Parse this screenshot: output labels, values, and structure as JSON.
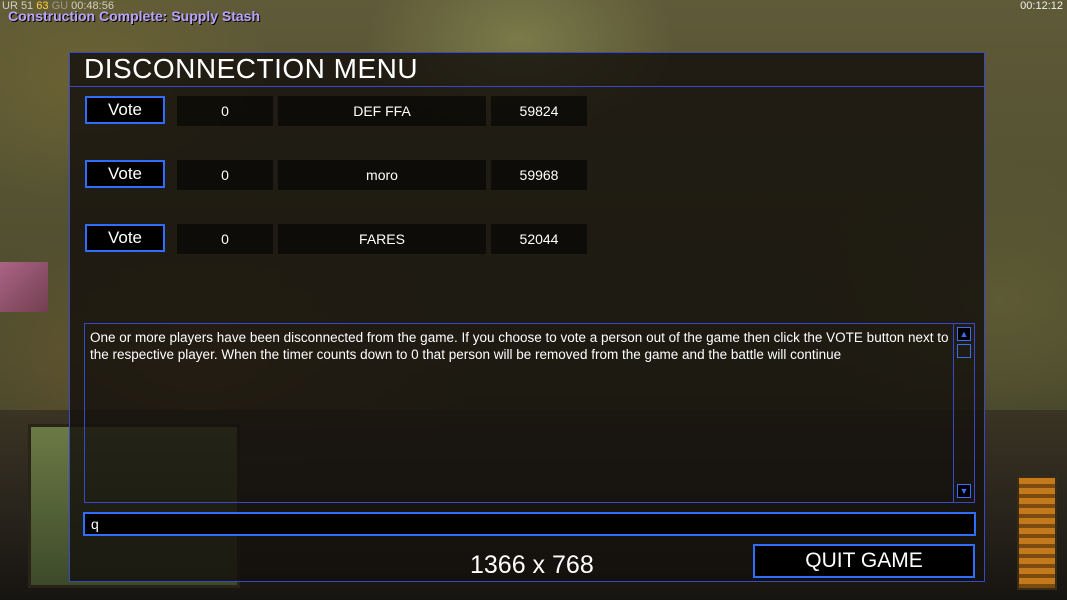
{
  "hud": {
    "stats_prefix": "UR 51",
    "stats_highlight": "63",
    "stats_dim": "GU",
    "stats_timer": "00:48:56",
    "notification": "Construction Complete: Supply Stash",
    "clock": "00:12:12"
  },
  "dialog": {
    "title": "DISCONNECTION MENU",
    "vote_label": "Vote",
    "players": [
      {
        "votes": "0",
        "name": "DEF FFA",
        "timer": "59824"
      },
      {
        "votes": "0",
        "name": "moro",
        "timer": "59968"
      },
      {
        "votes": "0",
        "name": "FARES",
        "timer": "52044"
      }
    ],
    "message": "One or more players have been disconnected from the game. If you choose to vote a person out of the game then click the VOTE button next to the respective player. When the timer counts down to 0 that person will be removed from the game and the battle will continue",
    "chat_value": "q",
    "resolution": "1366 x 768",
    "quit_label": "QUIT GAME"
  },
  "colors": {
    "accent_border": "#2f6dff",
    "dialog_bg": "#14100c",
    "notification_text": "#b8a4ff"
  }
}
